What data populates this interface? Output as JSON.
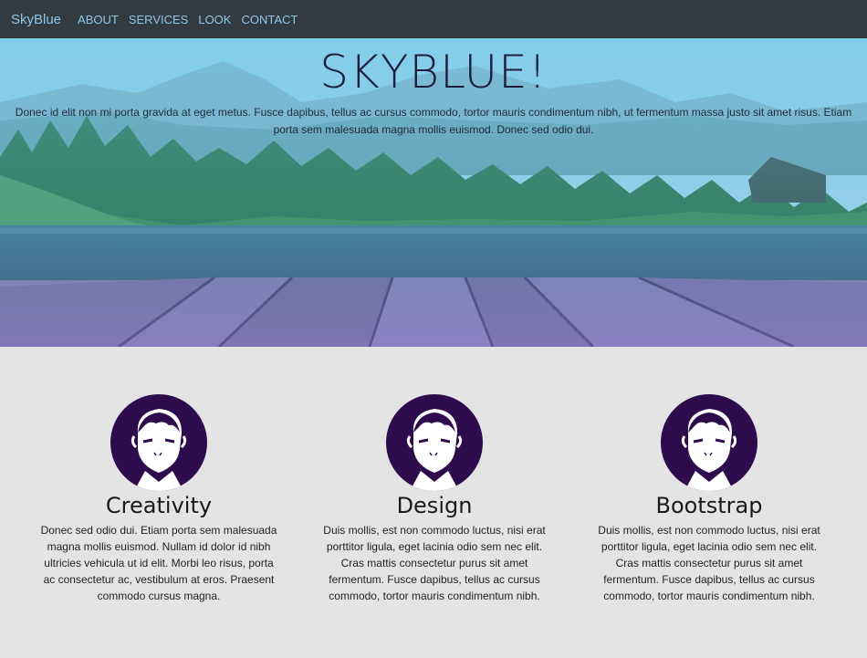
{
  "nav": {
    "brand": "SkyBlue",
    "links": [
      "ABOUT",
      "SERVICES",
      "LOOK",
      "CONTACT"
    ]
  },
  "hero": {
    "title": "SKYBLUE!",
    "text": "Donec id elit non mi porta gravida at eget metus. Fusce dapibus, tellus ac cursus commodo, tortor mauris condimentum nibh, ut fermentum massa justo sit amet risus. Etiam porta sem malesuada magna mollis euismod. Donec sed odio dui."
  },
  "features": [
    {
      "title": "Creativity",
      "text": "Donec sed odio dui. Etiam porta sem malesuada magna mollis euismod. Nullam id dolor id nibh ultricies vehicula ut id elit. Morbi leo risus, porta ac consectetur ac, vestibulum at eros. Praesent commodo cursus magna."
    },
    {
      "title": "Design",
      "text": "Duis mollis, est non commodo luctus, nisi erat porttitor ligula, eget lacinia odio sem nec elit. Cras mattis consectetur purus sit amet fermentum. Fusce dapibus, tellus ac cursus commodo, tortor mauris condimentum nibh."
    },
    {
      "title": "Bootstrap",
      "text": "Duis mollis, est non commodo luctus, nisi erat porttitor ligula, eget lacinia odio sem nec elit. Cras mattis consectetur purus sit amet fermentum. Fusce dapibus, tellus ac cursus commodo, tortor mauris condimentum nibh."
    }
  ],
  "colors": {
    "navbar_bg": "#333a40",
    "nav_text": "#8cc8ec",
    "avatar_bg": "#2d0b4d",
    "section_bg": "#e4e4e4"
  },
  "icons": {
    "avatar": "face-avatar-icon"
  }
}
